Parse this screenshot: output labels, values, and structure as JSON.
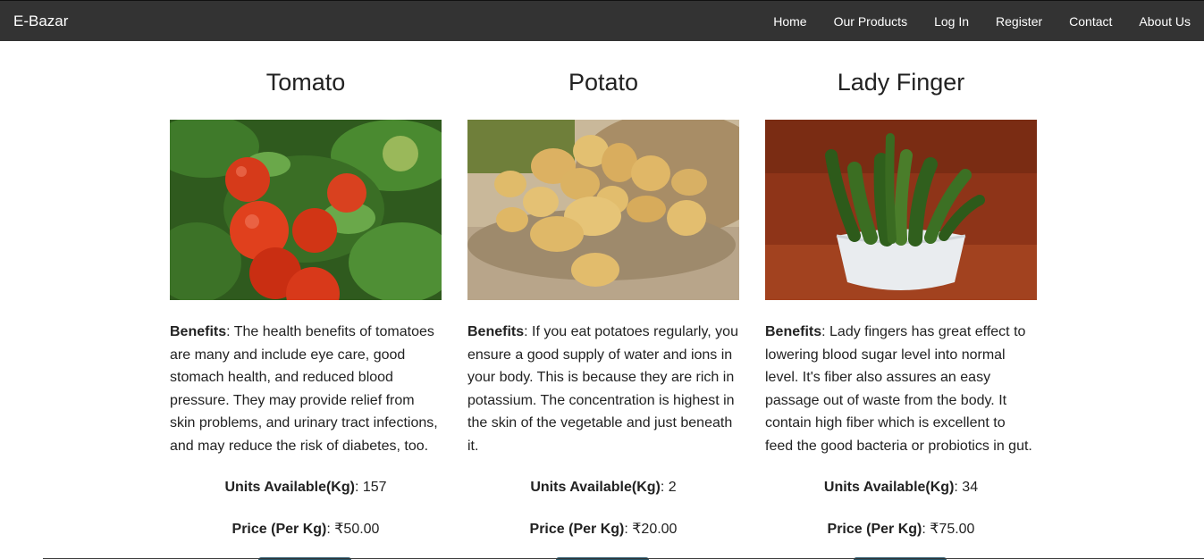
{
  "navbar": {
    "brand": "E-Bazar",
    "links": [
      "Home",
      "Our Products",
      "Log In",
      "Register",
      "Contact",
      "About Us"
    ]
  },
  "products": [
    {
      "name": "Tomato",
      "benefits_label": "Benefits",
      "benefits_text": ": The health benefits of tomatoes are many and include eye care, good stomach health, and reduced blood pressure. They may provide relief from skin problems, and urinary tract infections, and may reduce the risk of diabetes, too.",
      "units_label": "Units Available(Kg)",
      "units_value": ": 157",
      "price_label": "Price (Per Kg)",
      "price_value": ": ₹50.00"
    },
    {
      "name": "Potato",
      "benefits_label": "Benefits",
      "benefits_text": ": If you eat potatoes regularly, you ensure a good supply of water and ions in your body. This is because they are rich in potassium. The concentration is highest in the skin of the vegetable and just beneath it.",
      "units_label": "Units Available(Kg)",
      "units_value": ": 2",
      "price_label": "Price (Per Kg)",
      "price_value": ": ₹20.00"
    },
    {
      "name": "Lady Finger",
      "benefits_label": "Benefits",
      "benefits_text": ": Lady fingers has great effect to lowering blood sugar level into normal level. It's fiber also assures an easy passage out of waste from the body. It contain high fiber which is excellent to feed the good bacteria or probiotics in gut.",
      "units_label": "Units Available(Kg)",
      "units_value": ": 34",
      "price_label": "Price (Per Kg)",
      "price_value": ": ₹75.00"
    }
  ]
}
